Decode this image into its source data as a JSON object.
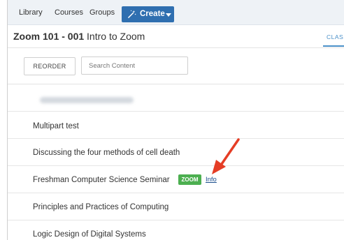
{
  "nav": {
    "items": [
      "Library",
      "Courses",
      "Groups"
    ],
    "create_label": "Create"
  },
  "course": {
    "title_code": "Zoom 101 - 001",
    "title_name": " Intro to Zoom",
    "tab_label": "CLASS"
  },
  "toolbar": {
    "reorder_label": "REORDER",
    "search_placeholder": "Search Content"
  },
  "content_items": [
    "Multipart test",
    "Discussing the four methods of cell death",
    "Freshman Computer Science Seminar",
    "Principles and Practices of Computing",
    "Logic Design of Digital Systems"
  ],
  "zoom_badge": "ZOOM",
  "info_link": "Info",
  "colors": {
    "create_button": "#2f6fb0",
    "zoom_badge": "#4caf50",
    "link": "#1a4d8c",
    "annotation_arrow": "#e53d25",
    "tab_accent": "#4a90c8"
  }
}
